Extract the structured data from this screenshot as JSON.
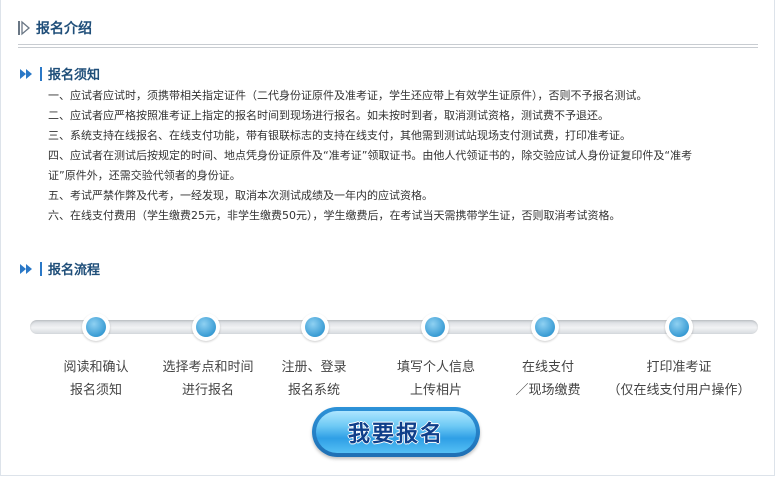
{
  "header": {
    "title": "报名介绍"
  },
  "notice": {
    "title": "报名须知",
    "items": [
      "一、应试者应试时，须携带相关指定证件（二代身份证原件及准考证，学生还应带上有效学生证原件），否则不予报名测试。",
      "二、应试者应严格按照准考证上指定的报名时间到现场进行报名。如未按时到者，取消测试资格，测试费不予退还。",
      "三、系统支持在线报名、在线支付功能，带有银联标志的支持在线支付，其他需到测试站现场支付测试费，打印准考证。",
      "四、应试者在测试后按规定的时间、地点凭身份证原件及“准考证”领取证书。由他人代领证书的，除交验应试人身份证复印件及“准考",
      "证”原件外，还需交验代领者的身份证。",
      "五、考试严禁作弊及代考，一经发现，取消本次测试成绩及一年内的应试资格。",
      "六、在线支付费用（学生缴费25元，非学生缴费50元），学生缴费后，在考试当天需携带学生证，否则取消考试资格。"
    ]
  },
  "process": {
    "title": "报名流程",
    "steps": [
      {
        "line1": "阅读和确认",
        "line2": "报名须知"
      },
      {
        "line1": "选择考点和时间",
        "line2": "进行报名"
      },
      {
        "line1": "注册、登录",
        "line2": "报名系统"
      },
      {
        "line1": "填写个人信息",
        "line2": "上传相片"
      },
      {
        "line1": "在线支付",
        "line2": "／现场缴费"
      },
      {
        "line1": "打印准考证",
        "line2": "（仅在线支付用户操作）"
      }
    ]
  },
  "cta": {
    "label": "我要报名"
  },
  "colors": {
    "accent": "#1f4e79",
    "bar": "#2a78c7",
    "button": "#2f9fe6"
  }
}
